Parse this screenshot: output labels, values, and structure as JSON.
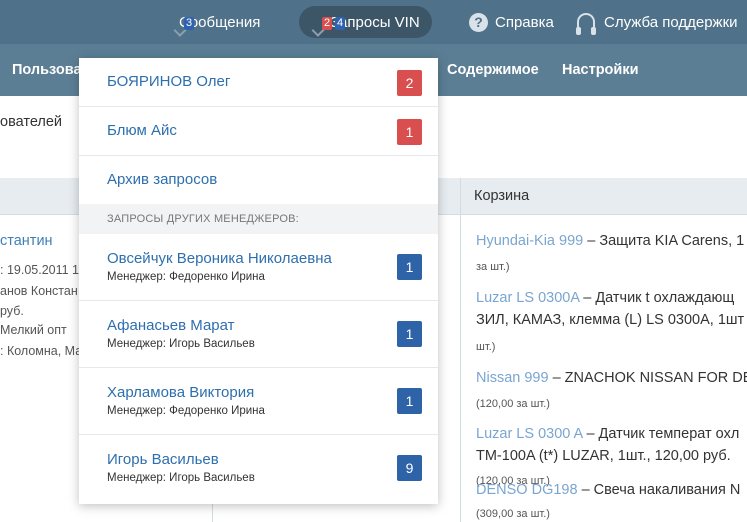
{
  "topbar": {
    "messages": {
      "label": "Сообщения",
      "count": "3"
    },
    "vin": {
      "label": "Запросы VIN",
      "count_red": "2",
      "count_blue": "4"
    },
    "help": {
      "label": "Справка",
      "icon_glyph": "?"
    },
    "support": {
      "label": "Служба поддержки"
    }
  },
  "menubar": {
    "users": "Пользова",
    "content": "Содержимое",
    "settings": "Настройки"
  },
  "page": {
    "subtitle": "ователей",
    "cart_header": "Корзина",
    "left": {
      "name": "стантин",
      "lines": [
        ": 19.05.2011 1",
        "анов Констан",
        "руб.",
        "Мелкий опт",
        ": Коломна, Ма"
      ]
    },
    "cart": [
      {
        "link": "Hyundai-Kia 999",
        "text": " – Защита KIA Carens, 1",
        "small": "за шт.)"
      },
      {
        "link": "Luzar LS 0300A",
        "text": " – Датчик t охлаждающ",
        "line2": "ЗИЛ, КАМАЗ, клемма (L) LS 0300A, 1шт",
        "small": "шт.)"
      },
      {
        "link": "Nissan 999",
        "text": " – ZNACHOK NISSAN FOR DE",
        "small": "(120,00 за шт.)"
      },
      {
        "link": "Luzar LS 0300 A",
        "text": " – Датчик температ охл",
        "line2": "TM-100A (t*) LUZAR, 1шт., 120,00 руб.",
        "small": "(120,00 за шт.)"
      },
      {
        "link": "DENSO DG198",
        "text": " – Свеча накаливания N",
        "small": "(309,00 за шт.)"
      }
    ]
  },
  "dropdown": {
    "items": [
      {
        "title": "БОЯРИНОВ Олег",
        "badge": "2",
        "badge_color": "#d94f4f"
      },
      {
        "title": "Блюм Айс",
        "badge": "1",
        "badge_color": "#d94f4f"
      },
      {
        "title": "Архив запросов"
      }
    ],
    "section_label": "ЗАПРОСЫ ДРУГИХ МЕНЕДЖЕРОВ:",
    "managers": [
      {
        "title": "Овсейчук Вероника Николаевна",
        "sub": "Менеджер: Федоренко Ирина",
        "badge": "1"
      },
      {
        "title": "Афанасьев Марат",
        "sub": "Менеджер: Игорь Васильев",
        "badge": "1"
      },
      {
        "title": "Харламова Виктория",
        "sub": "Менеджер: Федоренко Ирина",
        "badge": "1"
      },
      {
        "title": "Игорь Васильев",
        "sub": "Менеджер: Игорь Васильев",
        "badge": "9"
      }
    ]
  }
}
